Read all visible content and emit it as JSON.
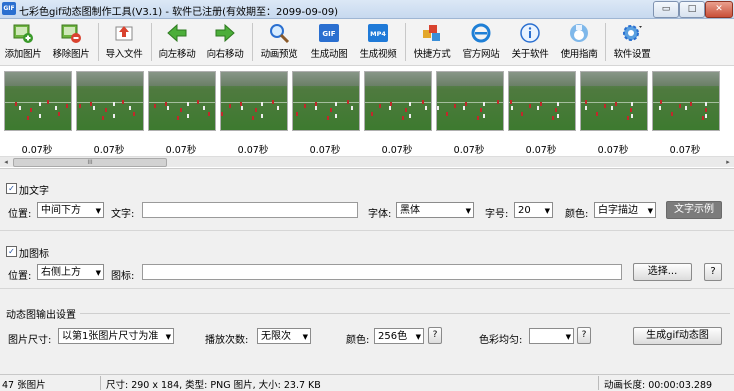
{
  "window": {
    "icon_text": "GIF",
    "title": "七彩色gif动态图制作工具(V3.1) - 软件已注册(有效期至：2099-09-09)",
    "minimize": "▭",
    "maximize": "□",
    "close": "✕"
  },
  "toolbar": [
    {
      "label": "添加图片",
      "icon": "add-image-icon"
    },
    {
      "label": "移除图片",
      "icon": "remove-image-icon"
    },
    {
      "label": "导入文件",
      "icon": "import-file-icon"
    },
    {
      "label": "向左移动",
      "icon": "arrow-left-icon"
    },
    {
      "label": "向右移动",
      "icon": "arrow-right-icon"
    },
    {
      "label": "动画预览",
      "icon": "magnifier-icon"
    },
    {
      "label": "生成动图",
      "icon": "gif-icon",
      "badge": "GIF"
    },
    {
      "label": "生成视频",
      "icon": "mp4-icon",
      "badge": "MP4"
    },
    {
      "label": "快捷方式",
      "icon": "shortcut-icon"
    },
    {
      "label": "官方网站",
      "icon": "ie-icon"
    },
    {
      "label": "关于软件",
      "icon": "info-icon"
    },
    {
      "label": "使用指南",
      "icon": "guide-icon"
    },
    {
      "label": "软件设置",
      "icon": "settings-gear-icon"
    }
  ],
  "frames": [
    {
      "delay": "0.07秒"
    },
    {
      "delay": "0.07秒"
    },
    {
      "delay": "0.07秒"
    },
    {
      "delay": "0.07秒"
    },
    {
      "delay": "0.07秒"
    },
    {
      "delay": "0.07秒"
    },
    {
      "delay": "0.07秒"
    },
    {
      "delay": "0.07秒"
    },
    {
      "delay": "0.07秒"
    },
    {
      "delay": "0.07秒"
    }
  ],
  "scroll": {
    "left": "◂",
    "right": "▸",
    "grip": "III"
  },
  "text_section": {
    "checkbox_label": "加文字",
    "checked_mark": "✓",
    "position_label": "位置:",
    "position_value": "中间下方",
    "text_label": "文字:",
    "text_value": "",
    "font_label": "字体:",
    "font_value": "黑体",
    "size_label": "字号:",
    "size_value": "20",
    "color_label": "颜色:",
    "color_value": "白字描边",
    "example_button": "文字示例"
  },
  "icon_section": {
    "checkbox_label": "加图标",
    "checked_mark": "✓",
    "position_label": "位置:",
    "position_value": "右侧上方",
    "icon_label": "图标:",
    "icon_value": "",
    "choose_button": "选择...",
    "help_button": "?"
  },
  "output_section": {
    "group_title": "动态图输出设置",
    "size_label": "图片尺寸:",
    "size_value": "以第1张图片尺寸为准",
    "loop_label": "播放次数:",
    "loop_value": "无限次",
    "colors_label": "颜色:",
    "colors_value": "256色",
    "colors_help": "?",
    "uniform_label": "色彩均匀:",
    "uniform_value": "",
    "uniform_help": "?",
    "generate_button": "生成gif动态图"
  },
  "status": {
    "count": "47 张图片",
    "info": "尺寸: 290 x 184, 类型: PNG 图片, 大小: 23.7 KB",
    "duration": "动画长度: 00:00:03.289"
  }
}
